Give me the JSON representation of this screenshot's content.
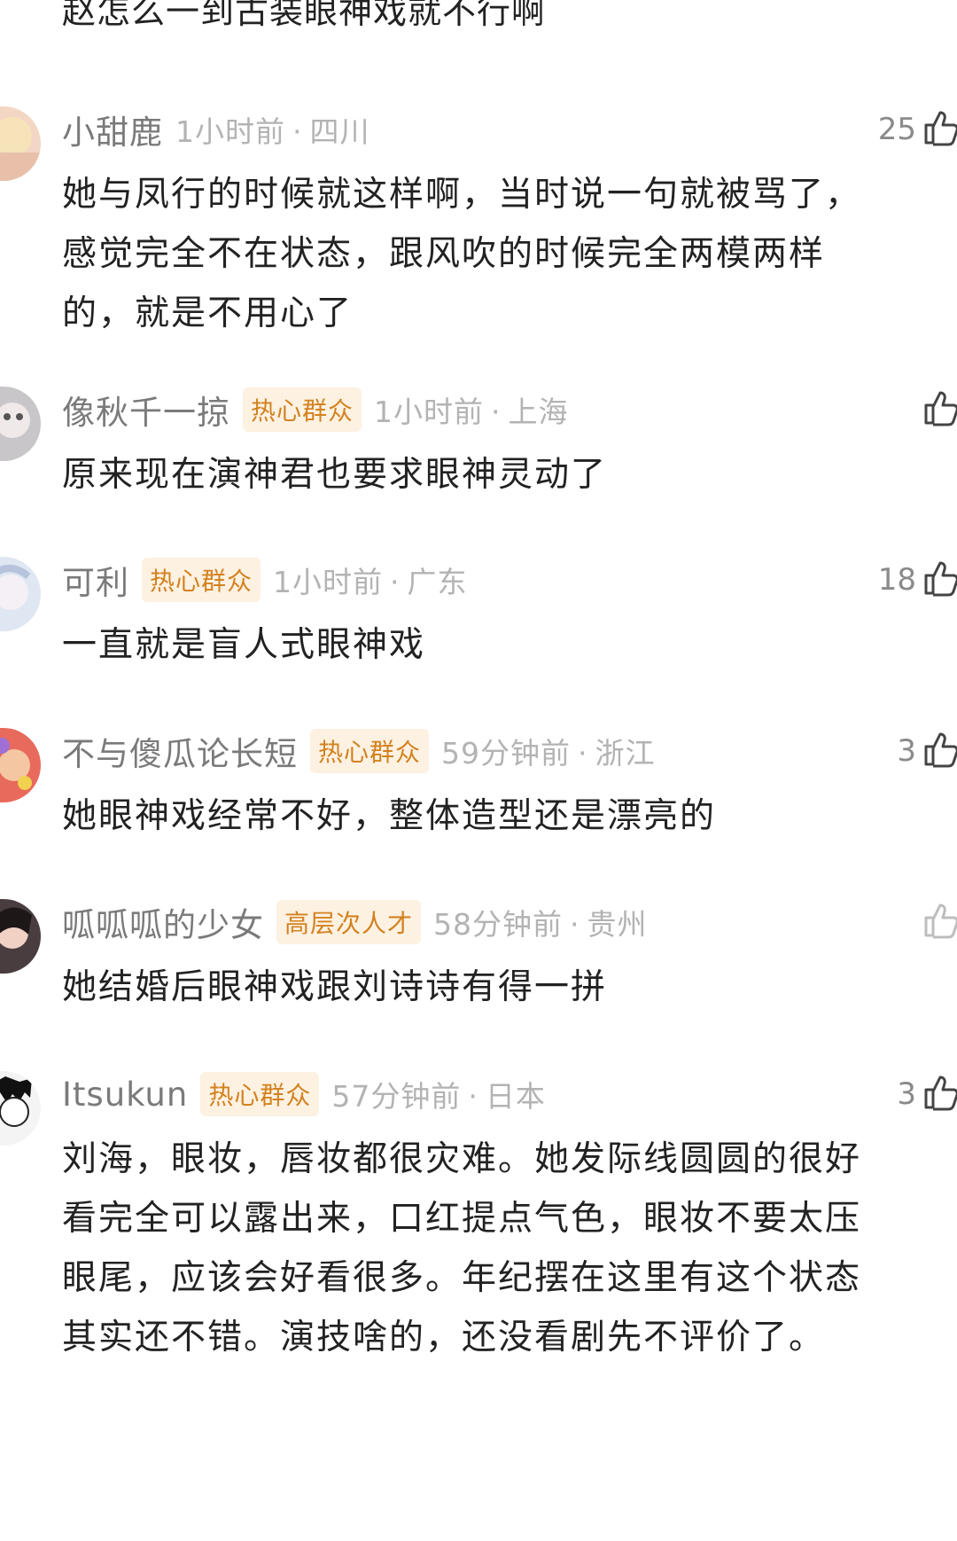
{
  "top_comment_tail": "赵怎么一到古装眼神戏就不行啊",
  "comments": [
    {
      "username": "小甜鹿",
      "badge": "",
      "time": "1小时前",
      "location": "四川",
      "likes": "25",
      "lines": [
        "她与凤行的时候就这样啊，当时说一句就被骂了，",
        "感觉完全不在状态，跟风吹的时候完全两模两样",
        "的，就是不用心了"
      ]
    },
    {
      "username": "像秋千一掠",
      "badge": "热心群众",
      "time": "1小时前",
      "location": "上海",
      "likes": "",
      "lines": [
        "原来现在演神君也要求眼神灵动了"
      ]
    },
    {
      "username": "可利",
      "badge": "热心群众",
      "time": "1小时前",
      "location": "广东",
      "likes": "18",
      "lines": [
        "一直就是盲人式眼神戏"
      ]
    },
    {
      "username": "不与傻瓜论长短",
      "badge": "热心群众",
      "time": "59分钟前",
      "location": "浙江",
      "likes": "3",
      "lines": [
        "她眼神戏经常不好，整体造型还是漂亮的"
      ]
    },
    {
      "username": "呱呱呱的少女",
      "badge": "高层次人才",
      "time": "58分钟前",
      "location": "贵州",
      "likes": "",
      "lines": [
        "她结婚后眼神戏跟刘诗诗有得一拼"
      ]
    },
    {
      "username": "Itsukun",
      "badge": "热心群众",
      "time": "57分钟前",
      "location": "日本",
      "likes": "3",
      "lines": [
        "刘海，眼妆，唇妆都很灾难。她发际线圆圆的很好",
        "看完全可以露出来，口红提点气色，眼妆不要太压",
        "眼尾，应该会好看很多。年纪摆在这里有这个状态",
        "其实还不错。演技啥的，还没看剧先不评价了。"
      ]
    }
  ],
  "icons": {
    "like": "thumbs-up-icon",
    "avatar": "avatar-image"
  },
  "colors": {
    "badge_text": "#d3821f",
    "badge_bg": "#fdf1e2",
    "meta": "#b3b3b3",
    "username": "#7a7a7a"
  }
}
